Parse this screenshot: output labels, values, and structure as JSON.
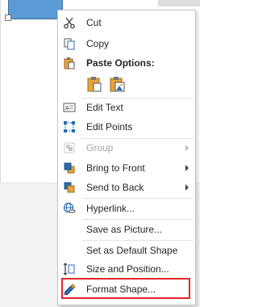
{
  "context_menu": {
    "cut": "Cut",
    "copy": "Copy",
    "paste_options": "Paste Options:",
    "edit_text": "Edit Text",
    "edit_points": "Edit Points",
    "group": "Group",
    "bring_to_front": "Bring to Front",
    "send_to_back": "Send to Back",
    "hyperlink": "Hyperlink...",
    "save_as_picture": "Save as Picture...",
    "set_default_shape": "Set as Default Shape",
    "size_and_position": "Size and Position...",
    "format_shape": "Format Shape..."
  },
  "icons": {
    "cut": "scissors-icon",
    "copy": "copy-icon",
    "paste": "clipboard-icon",
    "paste_keep": "paste-keep-formatting-icon",
    "paste_picture": "paste-as-picture-icon",
    "edit_text": "edit-text-icon",
    "edit_points": "edit-points-icon",
    "group": "group-icon",
    "bring_front": "bring-to-front-icon",
    "send_back": "send-to-back-icon",
    "hyperlink": "hyperlink-icon",
    "size_position": "size-position-icon",
    "format_shape": "format-shape-icon"
  },
  "colors": {
    "shape_fill": "#5b9bd5",
    "highlight_border": "#e0262b",
    "icon_orange": "#e8a33d",
    "icon_blue": "#2b6cb0"
  }
}
